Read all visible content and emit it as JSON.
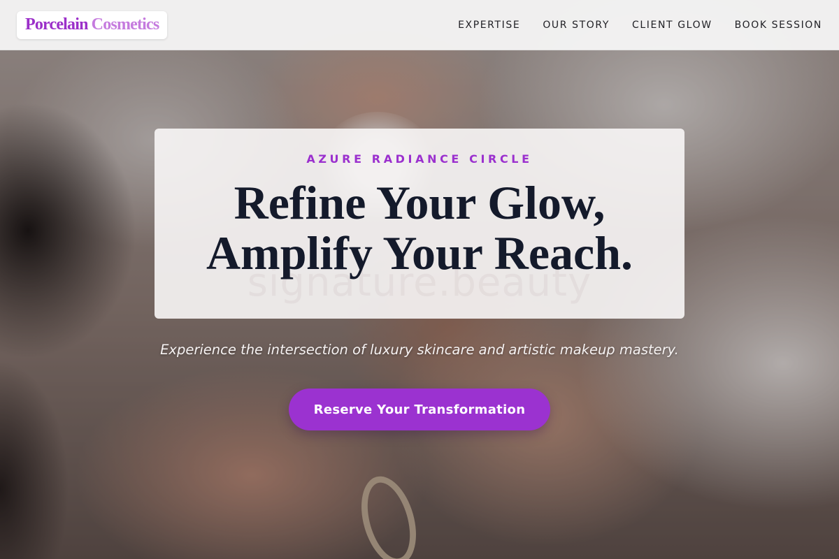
{
  "brand": {
    "name_part1": "Porcelain",
    "name_part2": "Cosmetics"
  },
  "nav": {
    "items": [
      {
        "label": "EXPERTISE"
      },
      {
        "label": "OUR STORY"
      },
      {
        "label": "CLIENT GLOW"
      },
      {
        "label": "BOOK SESSION"
      }
    ]
  },
  "hero": {
    "eyebrow": "AZURE RADIANCE CIRCLE",
    "headline_line1": "Refine Your Glow,",
    "headline_line2": "Amplify Your Reach.",
    "watermark": "signature.beauty",
    "subline": "Experience the intersection of luxury skincare and artistic makeup mastery.",
    "cta_label": "Reserve Your Transformation"
  },
  "colors": {
    "accent": "#9b32d0",
    "logo_primary": "#9b2fc9",
    "logo_secondary": "#c57bde",
    "headline": "#141a2b"
  }
}
